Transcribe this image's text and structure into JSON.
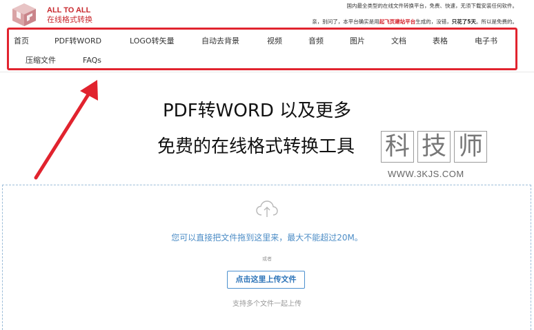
{
  "logo": {
    "title_en": "ALL TO ALL",
    "title_cn": "在线格式转换"
  },
  "notice": {
    "line1": "国内最全类型的在线文件转换平台，免费、快速，无须下载安装任何软件。",
    "line2_a": "亲，别问了，本平台确实是用",
    "line2_b": "起飞页建站平台",
    "line2_c": "生成的，没错，",
    "line2_d": "只花了5天",
    "line2_e": "。所以是免费的。"
  },
  "nav": {
    "items": [
      "首页",
      "PDF转WORD",
      "LOGO转矢量",
      "自动去背景",
      "视频",
      "音频",
      "图片",
      "文档",
      "表格",
      "电子书",
      "压缩文件",
      "FAQs"
    ]
  },
  "hero": {
    "title1": "PDF转WORD 以及更多",
    "title2": "免费的在线格式转换工具"
  },
  "watermark": {
    "chars": [
      "科",
      "技",
      "师"
    ],
    "url": "WWW.3KJS.COM"
  },
  "upload": {
    "drop_text": "您可以直接把文件拖到这里来，最大不能超过20M。",
    "or_text": "或者",
    "button_label": "点击这里上传文件",
    "multi_text": "支持多个文件一起上传"
  },
  "colors": {
    "brand_red": "#c8282d",
    "highlight_red": "#e1232e",
    "upload_blue": "#4d8dc6"
  }
}
